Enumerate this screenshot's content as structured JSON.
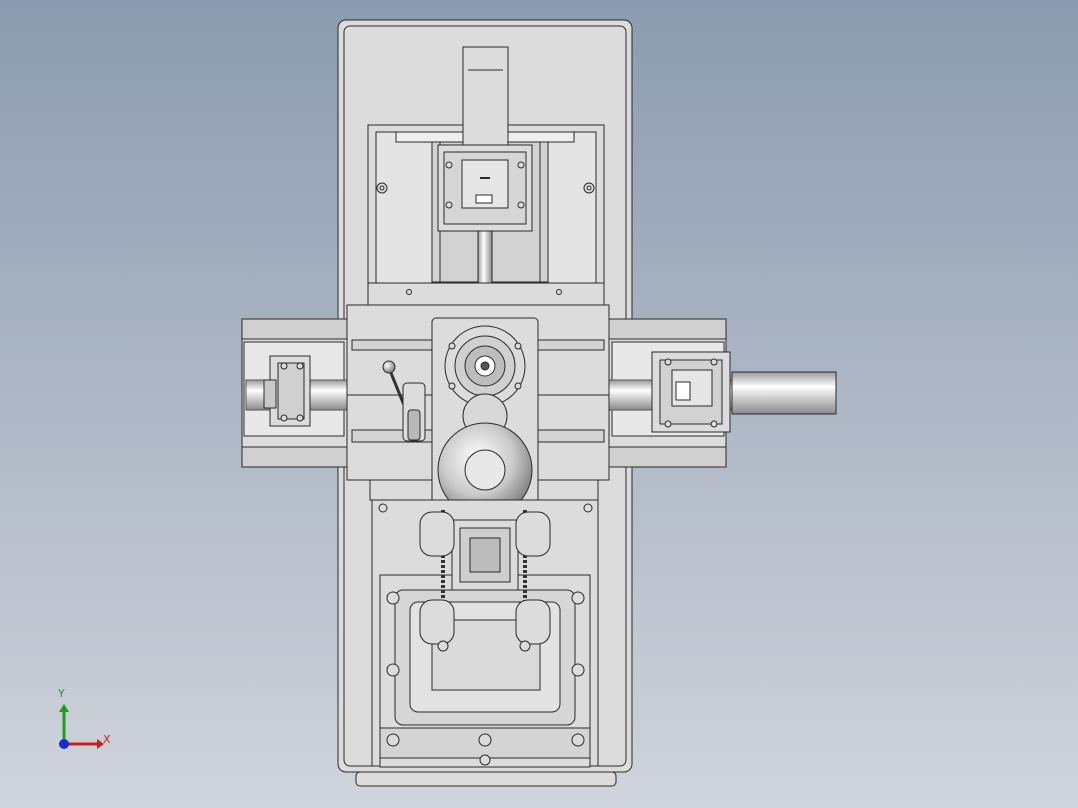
{
  "viewport": {
    "background_top": "#8C9BAF",
    "background_bottom": "#D0D4DC"
  },
  "model": {
    "body_color": "#DCDCDC",
    "edge_color": "#2A2A2A",
    "shade_color": "#A8A8A8"
  },
  "triad": {
    "x_label": "X",
    "y_label": "Y",
    "x_color": "#D01C1C",
    "y_color": "#1EA01E",
    "z_color": "#1C2AD0"
  }
}
